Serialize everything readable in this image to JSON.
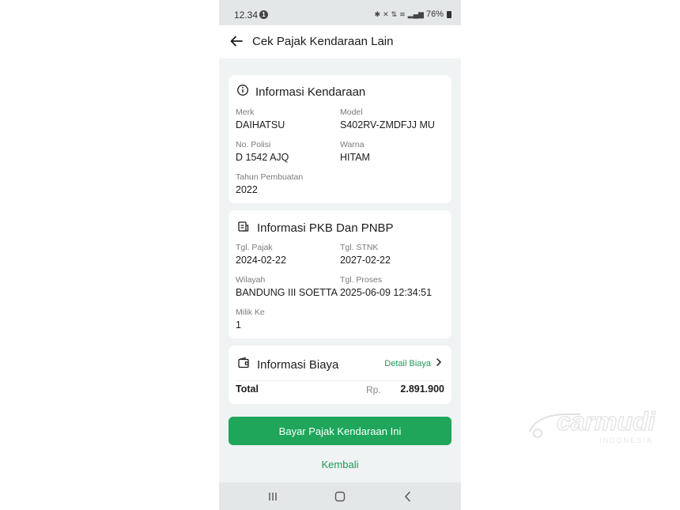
{
  "status_bar": {
    "time": "12.34",
    "notification_count": "1",
    "battery": "76%"
  },
  "app_bar": {
    "title": "Cek Pajak Kendaraan Lain"
  },
  "vehicle_info": {
    "title": "Informasi Kendaraan",
    "fields": {
      "merk": {
        "label": "Merk",
        "value": "DAIHATSU"
      },
      "model": {
        "label": "Model",
        "value": "S402RV-ZMDFJJ MU"
      },
      "no_polisi": {
        "label": "No. Polisi",
        "value": "D 1542 AJQ"
      },
      "warna": {
        "label": "Warna",
        "value": "HITAM"
      },
      "tahun": {
        "label": "Tahun Pembuatan",
        "value": "2022"
      }
    }
  },
  "pkb_info": {
    "title": "Informasi PKB Dan PNBP",
    "fields": {
      "tgl_pajak": {
        "label": "Tgl. Pajak",
        "value": "2024-02-22"
      },
      "tgl_stnk": {
        "label": "Tgl. STNK",
        "value": "2027-02-22"
      },
      "wilayah": {
        "label": "Wilayah",
        "value": "BANDUNG III SOETTA"
      },
      "tgl_proses": {
        "label": "Tgl. Proses",
        "value": "2025-06-09 12:34:51"
      },
      "milik_ke": {
        "label": "Milik Ke",
        "value": "1"
      }
    }
  },
  "cost_info": {
    "title": "Informasi Biaya",
    "detail_link": "Detail Biaya",
    "total_label": "Total",
    "currency": "Rp.",
    "total_value": "2.891.900"
  },
  "actions": {
    "pay_button": "Bayar Pajak Kendaraan Ini",
    "back_link": "Kembali"
  },
  "watermark": {
    "brand": "carmudi",
    "sub": "INDONESIA"
  },
  "colors": {
    "accent": "#1fa65b",
    "link": "#1e9a57",
    "page_bg": "#eff3f3"
  },
  "icons": {
    "back": "arrow-left-icon",
    "info": "info-circle-icon",
    "document": "document-icon",
    "wallet": "wallet-icon",
    "chevron": "chevron-right-icon"
  }
}
